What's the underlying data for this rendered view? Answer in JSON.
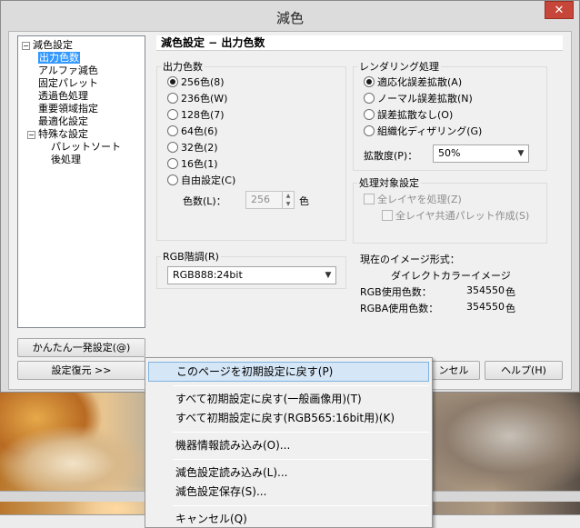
{
  "window": {
    "title": "減色",
    "close_glyph": "✕"
  },
  "tree": {
    "items": [
      {
        "label": "減色設定",
        "expander": "−",
        "level": 0
      },
      {
        "label": "出力色数",
        "level": 1,
        "selected": true
      },
      {
        "label": "アルファ減色",
        "level": 1
      },
      {
        "label": "固定パレット",
        "level": 1
      },
      {
        "label": "透過色処理",
        "level": 1
      },
      {
        "label": "重要領域指定",
        "level": 1
      },
      {
        "label": "最適化設定",
        "level": 1
      },
      {
        "label": "特殊な設定",
        "expander": "−",
        "level": 1
      },
      {
        "label": "パレットソート",
        "level": 2
      },
      {
        "label": "後処理",
        "level": 2
      }
    ]
  },
  "buttons": {
    "easy": "かんたん一発設定(@)",
    "restore": "設定復元 >>",
    "cancel_partial": "ンセル",
    "help": "ヘルプ(H)"
  },
  "header": {
    "title": "減色設定 − 出力色数"
  },
  "output_colors": {
    "group_title": "出力色数",
    "options": [
      {
        "label": "256色(8)",
        "checked": true
      },
      {
        "label": "236色(W)",
        "checked": false
      },
      {
        "label": "128色(7)",
        "checked": false
      },
      {
        "label": "64色(6)",
        "checked": false
      },
      {
        "label": "32色(2)",
        "checked": false
      },
      {
        "label": "16色(1)",
        "checked": false
      },
      {
        "label": "自由設定(C)",
        "checked": false
      }
    ],
    "count_label": "色数(L)：",
    "count_value": "256",
    "count_unit": "色"
  },
  "rendering": {
    "group_title": "レンダリング処理",
    "options": [
      {
        "label": "適応化誤差拡散(A)",
        "checked": true
      },
      {
        "label": "ノーマル誤差拡散(N)",
        "checked": false
      },
      {
        "label": "誤差拡散なし(O)",
        "checked": false
      },
      {
        "label": "組織化ディザリング(G)",
        "checked": false
      }
    ],
    "diffusion_label": "拡散度(P)：",
    "diffusion_value": "50%"
  },
  "target": {
    "group_title": "処理対象設定",
    "all_layers": "全レイヤを処理(Z)",
    "common_palette": "全レイヤ共通パレット作成(S)"
  },
  "rgb_level": {
    "group_title": "RGB階調(R)",
    "value": "RGB888:24bit"
  },
  "current_format": {
    "label": "現在のイメージ形式：",
    "type": "ダイレクトカラーイメージ",
    "rgb_label": "RGB使用色数：",
    "rgb_value": "354550",
    "rgba_label": "RGBA使用色数：",
    "rgba_value": "354550",
    "unit": "色"
  },
  "menu": {
    "items": [
      "このページを初期設定に戻す(P)",
      "すべて初期設定に戻す(一般画像用)(T)",
      "すべて初期設定に戻す(RGB565:16bit用)(K)",
      "機器情報読み込み(O)...",
      "減色設定読み込み(L)...",
      "減色設定保存(S)...",
      "キャンセル(Q)"
    ]
  }
}
